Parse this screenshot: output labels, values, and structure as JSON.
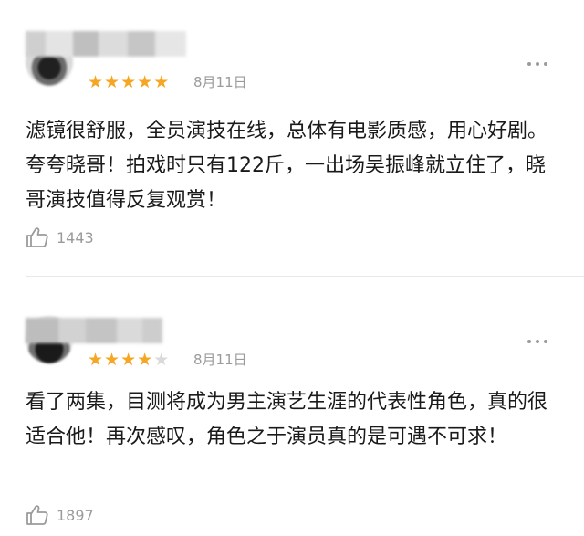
{
  "colors": {
    "star_on": "#f5a623",
    "star_off": "#d9d9d9",
    "meta_text": "#9b9b9b",
    "divider": "#e8e8e8"
  },
  "reviews": [
    {
      "rating": 5,
      "date": "8月11日",
      "content": "滤镜很舒服，全员演技在线，总体有电影质感，用心好剧。夸夸晓哥！拍戏时只有122斤，一出场吴振峰就立住了，晓哥演技值得反复观赏！",
      "likes": "1443",
      "icons": {
        "like": "thumbs-up-icon",
        "more": "more-dots-icon"
      }
    },
    {
      "rating": 4,
      "date": "8月11日",
      "content": "看了两集，目测将成为男主演艺生涯的代表性角色，真的很适合他！再次感叹，角色之于演员真的是可遇不可求！",
      "likes": "1897",
      "icons": {
        "like": "thumbs-up-icon",
        "more": "more-dots-icon"
      }
    }
  ]
}
